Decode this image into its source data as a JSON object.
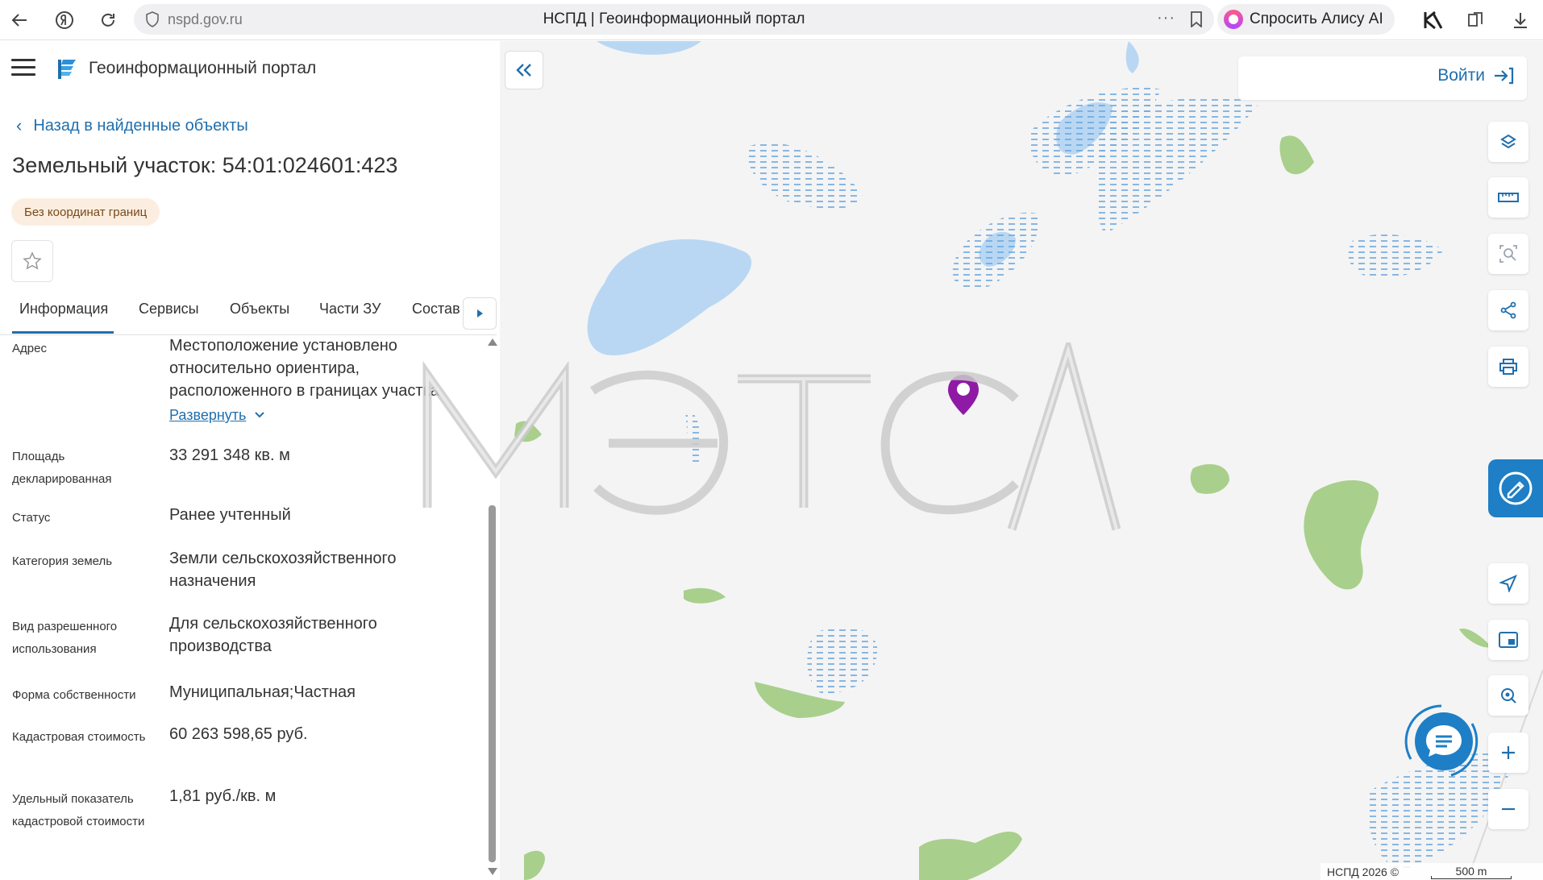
{
  "browser": {
    "url": "nspd.gov.ru",
    "page_title": "НСПД | Геоинформационный портал",
    "alice_label": "Спросить Алису AI"
  },
  "portal": {
    "name": "Геоинформационный портал",
    "back_label": "Назад в найденные объекты",
    "parcel_title": "Земельный участок: 54:01:024601:423",
    "badge": "Без координат границ"
  },
  "tabs": [
    {
      "label": "Информация",
      "active": true
    },
    {
      "label": "Сервисы"
    },
    {
      "label": "Объекты"
    },
    {
      "label": "Части ЗУ"
    },
    {
      "label": "Состав"
    }
  ],
  "info": {
    "address_label": "Адрес",
    "address_value": "Местоположение установлено относительно ориентира, расположенного в границах участка.",
    "expand_label": "Развернуть",
    "area_label": "Площадь декларированная",
    "area_value": "33 291 348 кв. м",
    "status_label": "Статус",
    "status_value": "Ранее учтенный",
    "category_label": "Категория земель",
    "category_value": "Земли сельскохозяйственного назначения",
    "use_label": "Вид разрешенного использования",
    "use_value": "Для сельскохозяйственного производства",
    "ownership_label": "Форма собственности",
    "ownership_value": "Муниципальная;Частная",
    "cadastral_cost_label": "Кадастровая стоимость",
    "cadastral_cost_value": "60 263 598,65 руб.",
    "specific_cost_label": "Удельный показатель кадастровой стоимости",
    "specific_cost_value": "1,81 руб./кв. м"
  },
  "map": {
    "login_label": "Войти",
    "attribution": "НСПД 2026 ©",
    "scale_label": "500 m",
    "watermark": "МЭТСЛ",
    "colors": {
      "water": "#b9d7f3",
      "water_lines": "#6aa7df",
      "forest": "#a9cf8c",
      "marker": "#8e1aa6",
      "accent": "#1f6fae"
    }
  },
  "icons": {
    "back": "arrow-left-icon",
    "yandex": "yandex-icon",
    "reload": "reload-icon",
    "shield": "shield-icon",
    "bookmark": "bookmark-icon",
    "layers": "layers-icon",
    "ruler": "ruler-icon",
    "search_area": "search-area-icon",
    "share": "share-icon",
    "print": "print-icon",
    "navigate": "navigate-icon",
    "minimap": "minimap-icon",
    "geolocate": "geolocate-icon",
    "zoom_in": "plus-icon",
    "zoom_out": "minus-icon",
    "chat": "chat-icon"
  }
}
